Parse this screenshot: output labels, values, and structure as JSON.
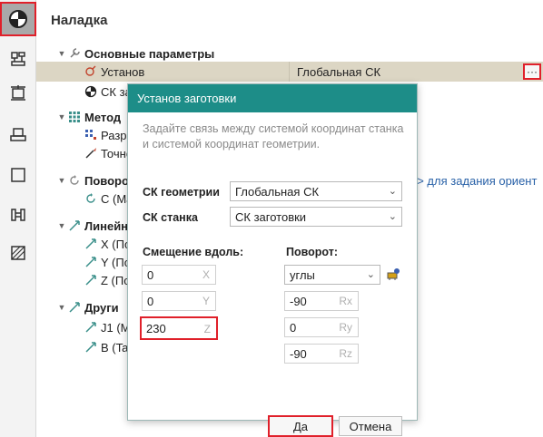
{
  "panel": {
    "title": "Наладка"
  },
  "tree": {
    "basic_params": "Основные параметры",
    "setup": "Установ",
    "setup_value": "Глобальная СК",
    "more": "···",
    "cs": "СК заг",
    "method": "Метод",
    "split": "Разре",
    "precision": "Точно",
    "rotation": "Поворо",
    "rotation_link": "..> для задания ориент",
    "c_axis": "C (Ma",
    "linear": "Линейн",
    "x": "X (По",
    "y": "Y (По",
    "z": "Z (По",
    "other": "Други",
    "j1": "J1 (M",
    "b": "B (Ta"
  },
  "dialog": {
    "title": "Установ заготовки",
    "hint": "Задайте связь между системой координат станка и системой координат геометрии.",
    "geom_cs_label": "СК геометрии",
    "geom_cs_value": "Глобальная СК",
    "machine_cs_label": "СК станка",
    "machine_cs_value": "СК заготовки",
    "offset_label": "Смещение вдоль:",
    "rotation_label": "Поворот:",
    "offset": [
      {
        "value": "0",
        "axis": "X"
      },
      {
        "value": "0",
        "axis": "Y"
      },
      {
        "value": "230",
        "axis": "Z"
      }
    ],
    "rotation_mode": "углы",
    "rotation_values": [
      {
        "value": "-90",
        "axis": "Rx"
      },
      {
        "value": "0",
        "axis": "Ry"
      },
      {
        "value": "-90",
        "axis": "Rz"
      }
    ],
    "ok": "Да",
    "cancel": "Отмена"
  },
  "colors": {
    "accent": "#1d8d88",
    "highlight": "#e0202a",
    "selected_row": "#dcd6c4",
    "link": "#2a62a8"
  }
}
